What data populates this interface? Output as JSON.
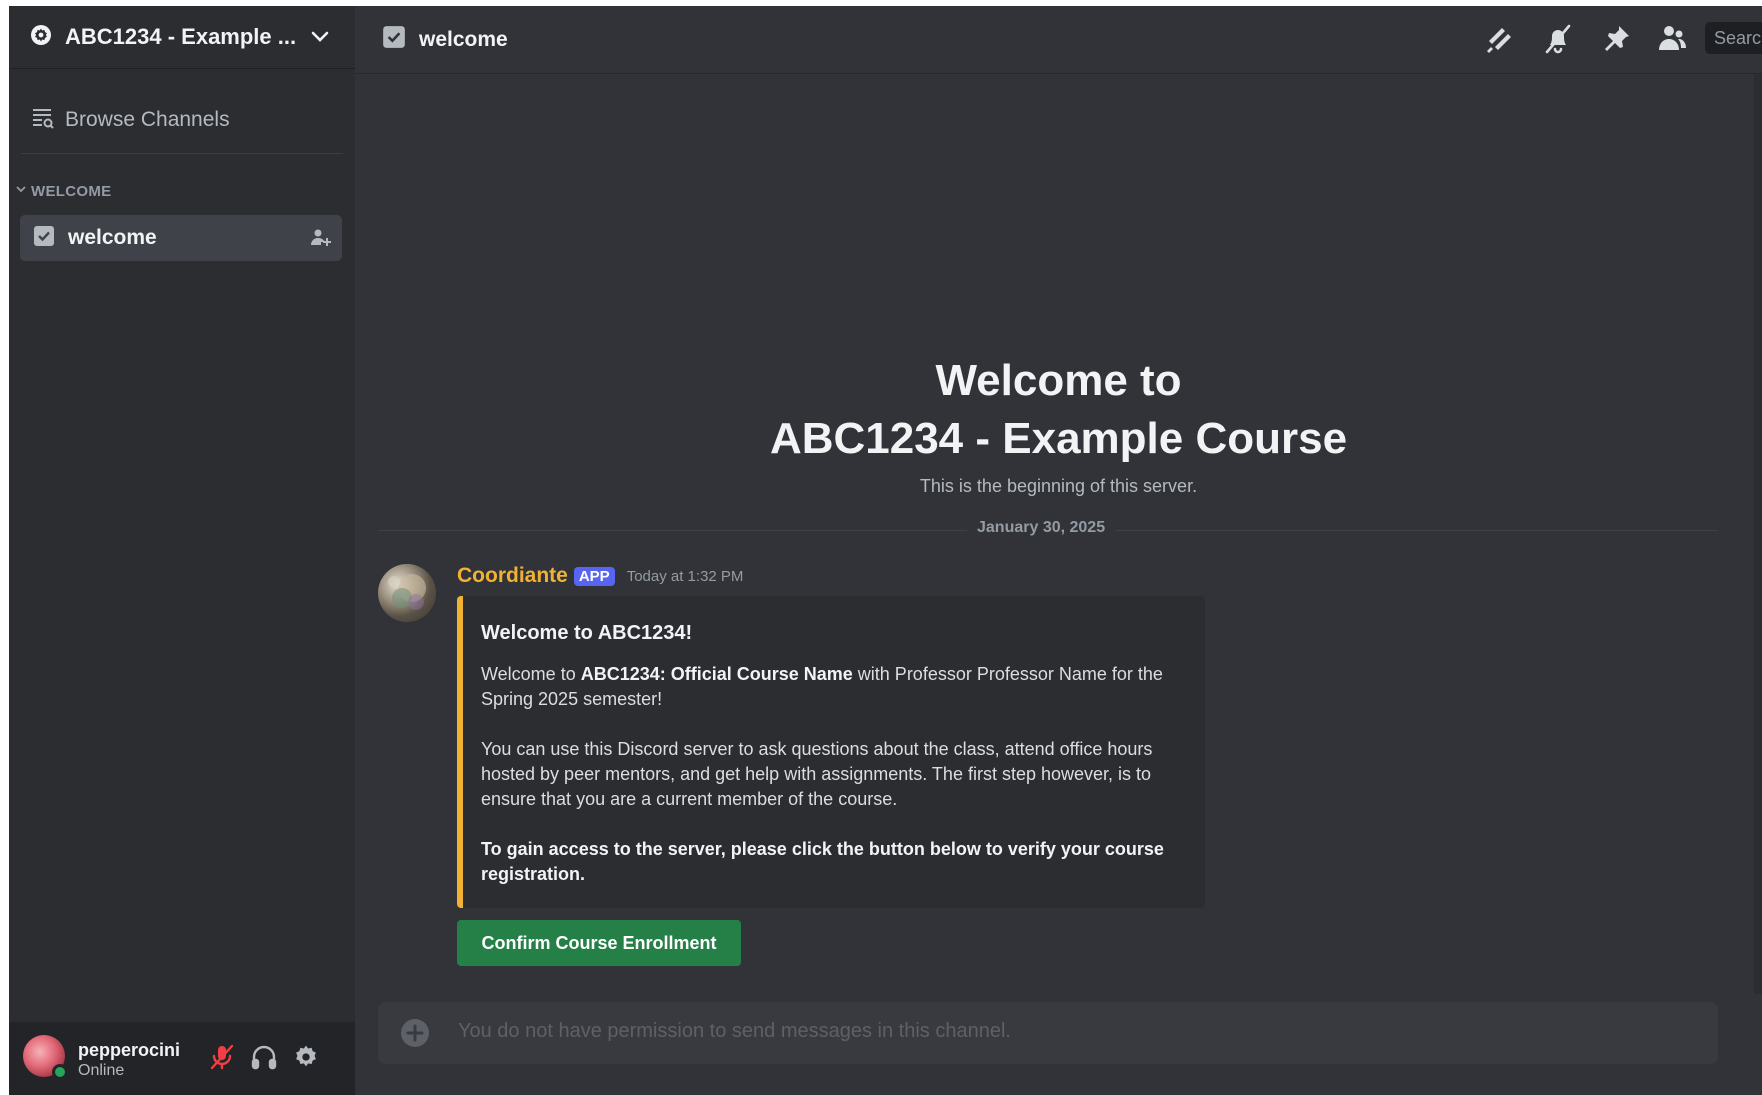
{
  "server": {
    "name": "ABC1234 - Example ...",
    "icon": "server-gear-icon",
    "dropdown_icon": "chevron-down-icon"
  },
  "sidebar": {
    "browse_label": "Browse Channels",
    "category": "WELCOME",
    "channels": [
      {
        "label": "welcome",
        "icon": "rules-channel-icon",
        "selected": true
      }
    ]
  },
  "user": {
    "name": "pepperocini",
    "status": "Online"
  },
  "topbar": {
    "channel": "welcome",
    "search_placeholder": "Search"
  },
  "welcome": {
    "title_line1": "Welcome to",
    "title_line2": "ABC1234 - Example Course",
    "subtitle": "This is the beginning of this server."
  },
  "date_divider": "January 30, 2025",
  "message": {
    "author": "Coordiante",
    "badge": "APP",
    "timestamp": "Today at 1:32 PM",
    "embed": {
      "title": "Welcome to ABC1234!",
      "p1_prefix": "Welcome to ",
      "p1_bold": "ABC1234: Official Course Name",
      "p1_suffix": " with Professor Professor Name for the Spring 2025 semester!",
      "p2": "You can use this Discord server to ask questions about the class, attend office hours hosted by peer mentors, and get help with assignments. The first step however, is to ensure that you are a current member of the course.",
      "p3": "To gain access to the server, please click the button below to verify your course registration."
    },
    "button_label": "Confirm Course Enrollment"
  },
  "composer": {
    "placeholder": "You do not have permission to send messages in this channel."
  },
  "colors": {
    "accent_author": "#f0b232",
    "badge_bg": "#5865f2",
    "button_green": "#248046",
    "online": "#23a55a",
    "muted_red": "#f23f43"
  }
}
